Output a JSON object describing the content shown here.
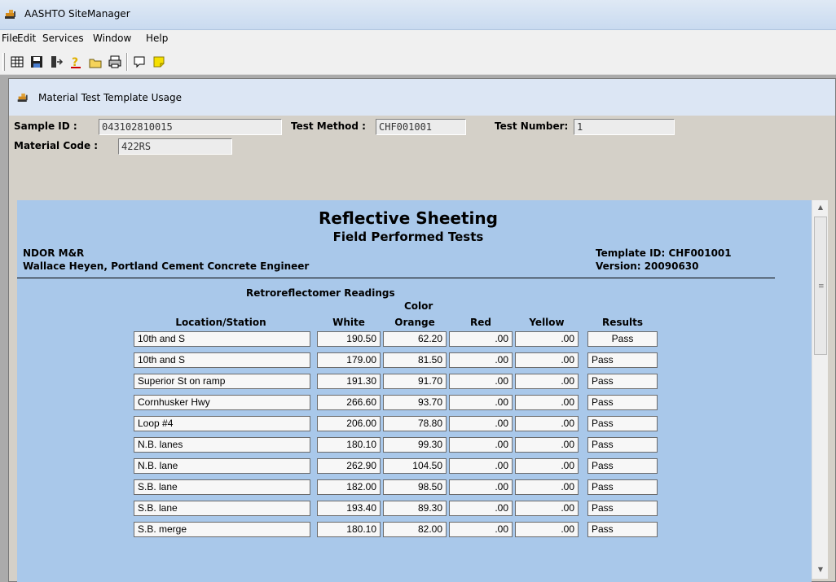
{
  "app": {
    "title": "AASHTO SiteManager"
  },
  "menu": [
    "File",
    "Edit",
    "Services",
    "Window",
    "Help"
  ],
  "window": {
    "title": "Material Test Template Usage"
  },
  "header": {
    "sample_id_label": "Sample ID :",
    "sample_id": "043102810015",
    "test_method_label": "Test Method :",
    "test_method": "CHF001001",
    "test_number_label": "Test Number:",
    "test_number": "1",
    "material_code_label": "Material Code :",
    "material_code": "422RS"
  },
  "report": {
    "title": "Reflective Sheeting",
    "subtitle": "Field Performed Tests",
    "org": "NDOR M&R",
    "engineer": "Wallace Heyen, Portland Cement Concrete Engineer",
    "template_id": "Template ID:  CHF001001",
    "version": "Version:  20090630",
    "section": "Retroreflectomer Readings",
    "color_label": "Color",
    "columns": [
      "Location/Station",
      "White",
      "Orange",
      "Red",
      "Yellow",
      "Results"
    ],
    "rows": [
      {
        "location": "10th and S",
        "white": "190.50",
        "orange": "62.20",
        "red": ".00",
        "yellow": ".00",
        "result": "Pass"
      },
      {
        "location": "10th and S",
        "white": "179.00",
        "orange": "81.50",
        "red": ".00",
        "yellow": ".00",
        "result": "Pass"
      },
      {
        "location": "Superior St on ramp",
        "white": "191.30",
        "orange": "91.70",
        "red": ".00",
        "yellow": ".00",
        "result": "Pass"
      },
      {
        "location": "Cornhusker Hwy",
        "white": "266.60",
        "orange": "93.70",
        "red": ".00",
        "yellow": ".00",
        "result": "Pass"
      },
      {
        "location": "Loop #4",
        "white": "206.00",
        "orange": "78.80",
        "red": ".00",
        "yellow": ".00",
        "result": "Pass"
      },
      {
        "location": "N.B. lanes",
        "white": "180.10",
        "orange": "99.30",
        "red": ".00",
        "yellow": ".00",
        "result": "Pass"
      },
      {
        "location": "N.B. lane",
        "white": "262.90",
        "orange": "104.50",
        "red": ".00",
        "yellow": ".00",
        "result": "Pass"
      },
      {
        "location": "S.B. lane",
        "white": "182.00",
        "orange": "98.50",
        "red": ".00",
        "yellow": ".00",
        "result": "Pass"
      },
      {
        "location": "S.B. lane",
        "white": "193.40",
        "orange": "89.30",
        "red": ".00",
        "yellow": ".00",
        "result": "Pass"
      },
      {
        "location": "S.B. merge",
        "white": "180.10",
        "orange": "82.00",
        "red": ".00",
        "yellow": ".00",
        "result": "Pass"
      }
    ]
  },
  "colors": {
    "report_bg": "#a9c8ea",
    "titlebar": "#c9daf0"
  },
  "toolbar_icons": [
    "grid-icon",
    "save-icon",
    "exit-icon",
    "help-icon",
    "open-folder-icon",
    "print-icon",
    "comment-icon",
    "note-icon"
  ]
}
